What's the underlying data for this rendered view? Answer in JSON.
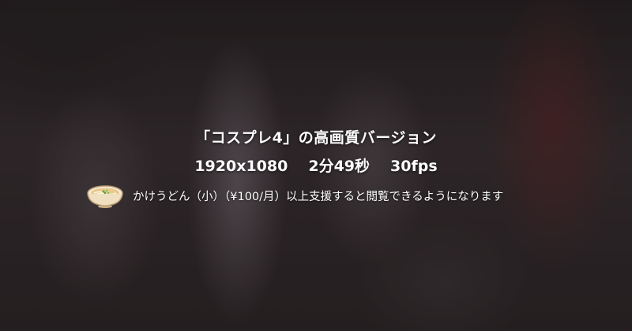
{
  "content": {
    "title": "「コスプレ4」の高画質バージョン",
    "specs": {
      "resolution": "1920x1080",
      "duration": "2分49秒",
      "framerate": "30fps"
    },
    "support_notice": "かけうどん（小）（¥100/月）以上支援すると閲覧できるようになります",
    "tier_icon": "udon-bowl-icon"
  },
  "colors": {
    "text": "#ffffff",
    "bowl": "#f4e2c4",
    "broth": "#e8c98e"
  }
}
